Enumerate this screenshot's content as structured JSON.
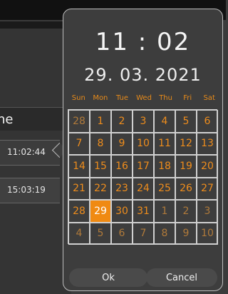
{
  "background": {
    "header_text": "ne",
    "rows": [
      "11:02:44",
      "15:03:19"
    ]
  },
  "picker": {
    "time": "11 : 02",
    "date": "29. 03. 2021",
    "weekdays": [
      "Sun",
      "Mon",
      "Tue",
      "Wed",
      "Thu",
      "Fri",
      "Sat"
    ],
    "days": [
      [
        "28",
        "1",
        "2",
        "3",
        "4",
        "5",
        "6"
      ],
      [
        "7",
        "8",
        "9",
        "10",
        "11",
        "12",
        "13"
      ],
      [
        "14",
        "15",
        "16",
        "17",
        "18",
        "19",
        "20"
      ],
      [
        "21",
        "22",
        "23",
        "24",
        "25",
        "26",
        "27"
      ],
      [
        "28",
        "29",
        "30",
        "31",
        "1",
        "2",
        "3"
      ],
      [
        "4",
        "5",
        "6",
        "7",
        "8",
        "9",
        "10"
      ]
    ],
    "selected_day": "29",
    "ok_label": "Ok",
    "cancel_label": "Cancel",
    "accent_color": "#f08a12"
  }
}
